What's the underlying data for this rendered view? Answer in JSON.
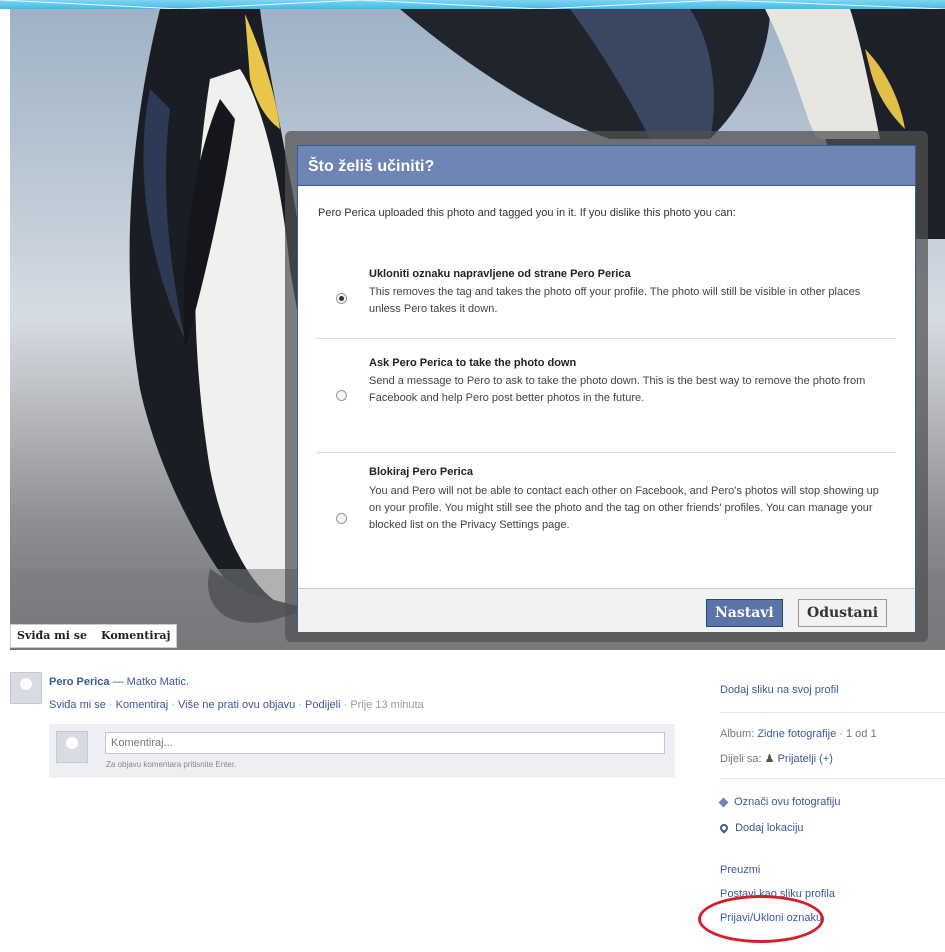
{
  "photo_actions": {
    "like": "Sviđa mi se",
    "comment": "Komentiraj"
  },
  "dialog": {
    "title": "Što želiš učiniti?",
    "intro": "Pero Perica uploaded this photo and tagged you in it. If you dislike this photo you can:",
    "options": [
      {
        "title": "Ukloniti oznaku napravljene od strane Pero Perica",
        "desc": "This removes the tag and takes the photo off your profile. The photo will still be visible in other places unless Pero takes it down.",
        "checked": true
      },
      {
        "title": "Ask Pero Perica to take the photo down",
        "desc": "Send a message to Pero to ask to take the photo down. This is the best way to remove the photo from Facebook and help Pero post better photos in the future.",
        "checked": false
      },
      {
        "title": "Blokiraj Pero Perica",
        "desc": "You and Pero will not be able to contact each other on Facebook, and Pero's photos will stop showing up on your profile. You might still see the photo and the tag on other friends' profiles. You can manage your blocked list on the Privacy Settings page.",
        "checked": false
      }
    ],
    "continue_label": "Nastavi",
    "cancel_label": "Odustani"
  },
  "post": {
    "author": "Pero Perica",
    "with_text": "— Matko Matic.",
    "like": "Sviđa mi se",
    "comment": "Komentiraj",
    "unfollow": "Više ne prati ovu objavu",
    "share": "Podijeli",
    "time": "Prije 13 minuta",
    "comment_placeholder": "Komentiraj...",
    "comment_hint": "Za objavu komentara pritisnite Enter."
  },
  "sidebar": {
    "add_profile": "Dodaj sliku na svoj profil",
    "album_label": "Album:",
    "album_name": "Zidne fotografije",
    "album_count": "· 1 od 1",
    "shared_label": "Dijeli sa:",
    "shared_value": "Prijatelji (+)",
    "tag_photo": "Označi ovu fotografiju",
    "add_location": "Dodaj lokaciju",
    "download": "Preuzmi",
    "make_profile": "Postavi kao sliku profila",
    "report_untag": "Prijavi/Ukloni oznaku"
  },
  "colors": {
    "facebook_blue": "#3b5998",
    "dialog_header": "#6d84b4",
    "highlight_red": "#d41f2b"
  }
}
